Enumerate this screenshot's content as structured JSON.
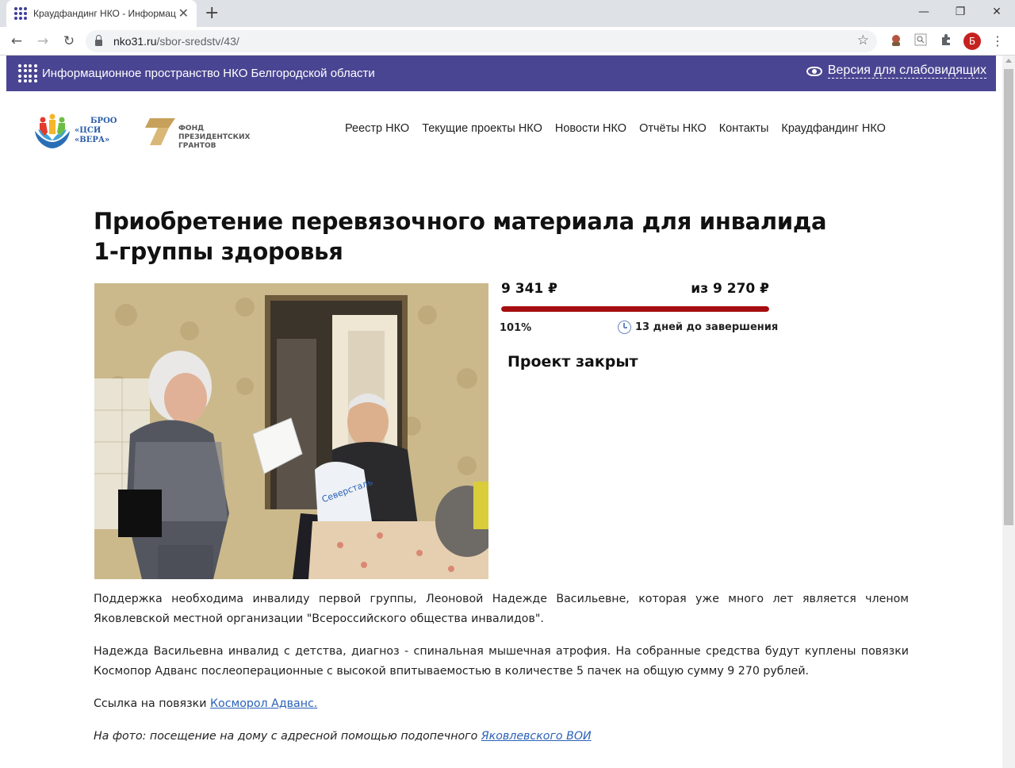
{
  "browser": {
    "tab_title": "Краудфандинг НКО - Информац",
    "url_host": "nko31.ru",
    "url_path": "/sbor-sredstv/43/",
    "profile_initial": "Б"
  },
  "site": {
    "title": "Информационное пространство НКО Белгородской области",
    "accessibility_link": "Версия для слабовидящих"
  },
  "logos": {
    "broo_line1": "БРОО",
    "broo_line2": "«ЦСИ «ВЕРА»",
    "fpg_line1": "ФОНД",
    "fpg_line2": "ПРЕЗИДЕНТСКИХ",
    "fpg_line3": "ГРАНТОВ"
  },
  "nav": [
    "Реестр НКО",
    "Текущие проекты НКО",
    "Новости НКО",
    "Отчёты НКО",
    "Контакты",
    "Краудфандинг НКО"
  ],
  "project": {
    "title": "Приобретение перевязочного материала для инвалида 1-группы здоровья",
    "raised": "9 341 ₽",
    "goal": "из 9 270 ₽",
    "percent": "101%",
    "progress_fraction": 1.0,
    "days_left": "13 дней до завершения",
    "status": "Проект закрыт",
    "photo_bag_text": "Северсталь"
  },
  "description": {
    "p1": "Поддержка необходима инвалиду первой группы, Леоновой Надежде Васильевне, которая уже много лет является членом Яковлевской местной организации \"Всероссийского общества инвалидов\".",
    "p2": "Надежда Васильевна инвалид с детства, диагноз - спинальная мышечная атрофия. На собранные средства будут куплены повязки Космопор Адванс послеоперационные с высокой впитываемостью в количестве 5 пачек на общую сумму 9 270 рублей.",
    "p3_prefix": "Ссылка на повязки ",
    "p3_link": "Косморол Адванс.",
    "caption_prefix": "На фото: посещение на дому с адресной помощью подопечного ",
    "caption_link": "Яковлевского ВОИ"
  },
  "colors": {
    "site_bar": "#4a4592",
    "progress": "#a50e10",
    "link": "#2a62b8"
  }
}
